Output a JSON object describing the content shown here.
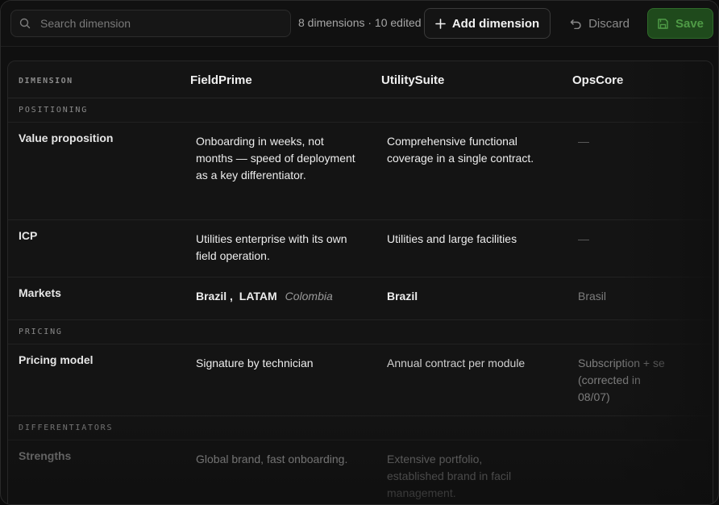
{
  "toolbar": {
    "search_placeholder": "Search dimension",
    "count_text": "8 dimensions · 10 edited",
    "add_label": "Add dimension",
    "discard_label": "Discard",
    "save_label": "Save"
  },
  "table": {
    "dimension_header": "DIMENSION",
    "columns": [
      "FieldPrime",
      "UtilitySuite",
      "OpsCore"
    ],
    "sections": {
      "positioning": "POSITIONING",
      "pricing": "PRICING",
      "differentiators": "DIFFERENTIATORS"
    },
    "rows": {
      "value_proposition": {
        "label": "Value proposition",
        "cells": [
          "Onboarding in weeks, not months — speed of deployment as a key differentiator.",
          "Comprehensive functional coverage in a single contract.",
          "—"
        ]
      },
      "icp": {
        "label": "ICP",
        "cells": [
          "Utilities enterprise with its own field operation.",
          "Utilities and large facilities",
          "—"
        ]
      },
      "markets": {
        "label": "Markets",
        "fieldprime_tags": [
          "Brazil ,",
          "LATAM"
        ],
        "fieldprime_extra": "Colombia",
        "cells": [
          "Brazil",
          "Brasil"
        ]
      },
      "pricing_model": {
        "label": "Pricing model",
        "cells": [
          "Signature by technician",
          "Annual contract per module",
          "Subscription + se (corrected in 08/07)"
        ]
      },
      "strengths": {
        "label": "Strengths",
        "cells": [
          "Global brand, fast onboarding.",
          "Extensive portfolio, established brand in facil management."
        ]
      }
    }
  },
  "colors": {
    "save_bg": "#1f4a1c",
    "save_text": "#4f9b46",
    "background": "#101010"
  }
}
